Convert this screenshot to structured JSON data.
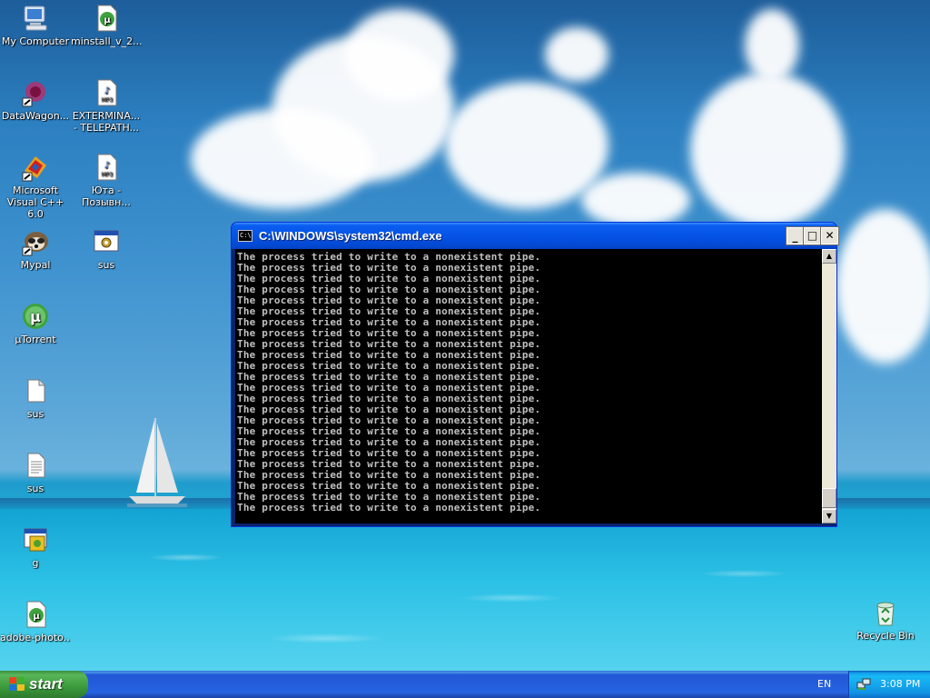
{
  "desktop": {
    "icons": [
      {
        "label": "My Computer"
      },
      {
        "label": "minstall_v_2..."
      },
      {
        "label": "DataWagon..."
      },
      {
        "label": "EXTERMINA... - TELEPATH..."
      },
      {
        "label": "Microsoft Visual C++ 6.0"
      },
      {
        "label": "Юта - Позывн..."
      },
      {
        "label": "Mypal"
      },
      {
        "label": "sus"
      },
      {
        "label": "µTorrent"
      },
      {
        "label": "sus"
      },
      {
        "label": "sus"
      },
      {
        "label": "g"
      },
      {
        "label": "adobe-photo..."
      },
      {
        "label": "Recycle Bin"
      }
    ]
  },
  "cmd_window": {
    "title": "C:\\WINDOWS\\system32\\cmd.exe",
    "icon_text": "C:\\",
    "minimize_label": "_",
    "maximize_label": "□",
    "close_label": "✕",
    "line": "The process tried to write to a nonexistent pipe.",
    "line_count": 24
  },
  "taskbar": {
    "start_label": "start",
    "language": "EN",
    "clock": "3:08 PM"
  },
  "colors": {
    "titlebar": "#0553e6",
    "console_bg": "#000000",
    "console_fg": "#c0c0c0",
    "taskbar": "#2663e0",
    "start_green": "#3c9a3c"
  }
}
